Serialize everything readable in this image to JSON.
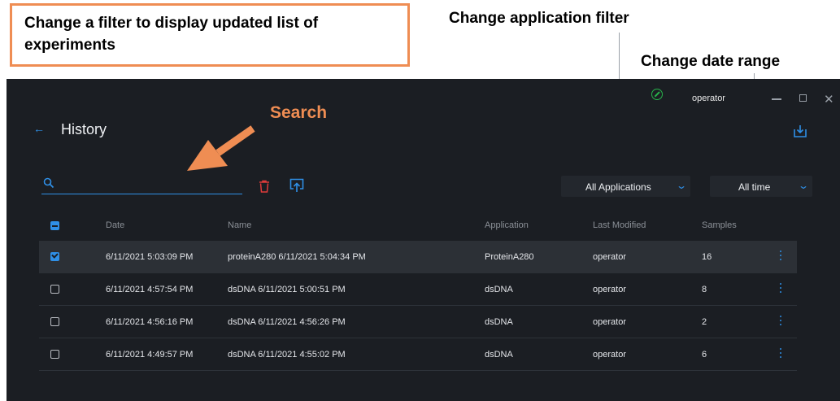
{
  "annotations": {
    "callout_box": "Change a filter to display updated list of experiments",
    "application_filter": "Change application filter",
    "date_range": "Change date range",
    "search": "Search"
  },
  "window": {
    "user": "operator",
    "status_color": "#27b34a"
  },
  "header": {
    "back_icon": "back-arrow-icon",
    "title": "History",
    "export_icon": "export-icon"
  },
  "toolbar": {
    "search_value": "",
    "search_placeholder": "",
    "delete_icon": "trash-icon",
    "import_icon": "import-icon",
    "application_filter": "All Applications",
    "date_filter": "All time"
  },
  "table": {
    "columns": [
      "Date",
      "Name",
      "Application",
      "Last Modified",
      "Samples"
    ],
    "header_checkbox": "partial",
    "rows": [
      {
        "date": "6/11/2021 5:03:09 PM",
        "name": "proteinA280 6/11/2021 5:04:34 PM",
        "application": "ProteinA280",
        "modified": "operator",
        "samples": "16",
        "checked": true
      },
      {
        "date": "6/11/2021 4:57:54 PM",
        "name": "dsDNA 6/11/2021 5:00:51 PM",
        "application": "dsDNA",
        "modified": "operator",
        "samples": "8",
        "checked": false
      },
      {
        "date": "6/11/2021 4:56:16 PM",
        "name": "dsDNA 6/11/2021 4:56:26 PM",
        "application": "dsDNA",
        "modified": "operator",
        "samples": "2",
        "checked": false
      },
      {
        "date": "6/11/2021 4:49:57 PM",
        "name": "dsDNA 6/11/2021 4:55:02 PM",
        "application": "dsDNA",
        "modified": "operator",
        "samples": "6",
        "checked": false
      }
    ]
  },
  "colors": {
    "accent": "#2f8fe6",
    "annotation_orange": "#ef8d53",
    "background": "#1b1e23",
    "delete_red": "#e03b3b"
  }
}
